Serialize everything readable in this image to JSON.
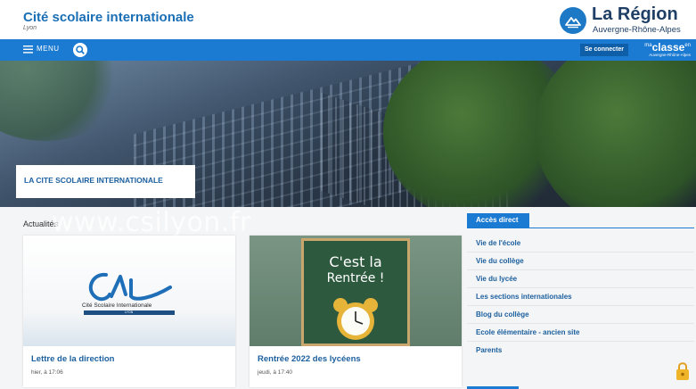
{
  "header": {
    "title": "Cité scolaire internationale",
    "subtitle": "Lyon",
    "region_name": "La Région",
    "region_sub": "Auvergne-Rhône-Alpes"
  },
  "nav": {
    "menu_label": "MENU",
    "login_label": "Se connecter",
    "maclasse_prefix": "ma",
    "maclasse_main": "classe",
    "maclasse_suffix": "en",
    "maclasse_sub": "Auvergne-Rhône-Alpes"
  },
  "hero": {
    "caption": "LA CITE SCOLAIRE INTERNATIONALE"
  },
  "news": {
    "heading": "Actualités",
    "watermark": "www.csilyon.fr",
    "cards": [
      {
        "title": "Lettre de la direction",
        "date": "hier, à 17:06",
        "logo_text": "Cité Scolaire Internationale",
        "logo_bar": "LYON"
      },
      {
        "title": "Rentrée 2022 des lycéens",
        "date": "jeudi, à 17:40",
        "board_line1": "C'est la",
        "board_line2": "Rentrée !"
      }
    ]
  },
  "access": {
    "heading": "Accès direct",
    "items": [
      "Vie de l'école",
      "Vie du collège",
      "Vie du lycée",
      "Les sections internationales",
      "Blog du collège",
      "Ecole élémentaire - ancien site",
      "Parents"
    ]
  },
  "colors": {
    "primary": "#1b7ad1",
    "title": "#1b6fb5",
    "link": "#1b5f9e",
    "region": "#1f3f66",
    "lock": "#f0b429"
  },
  "icons": [
    "hamburger-icon",
    "search-icon",
    "region-mountain-icon",
    "lock-icon"
  ]
}
